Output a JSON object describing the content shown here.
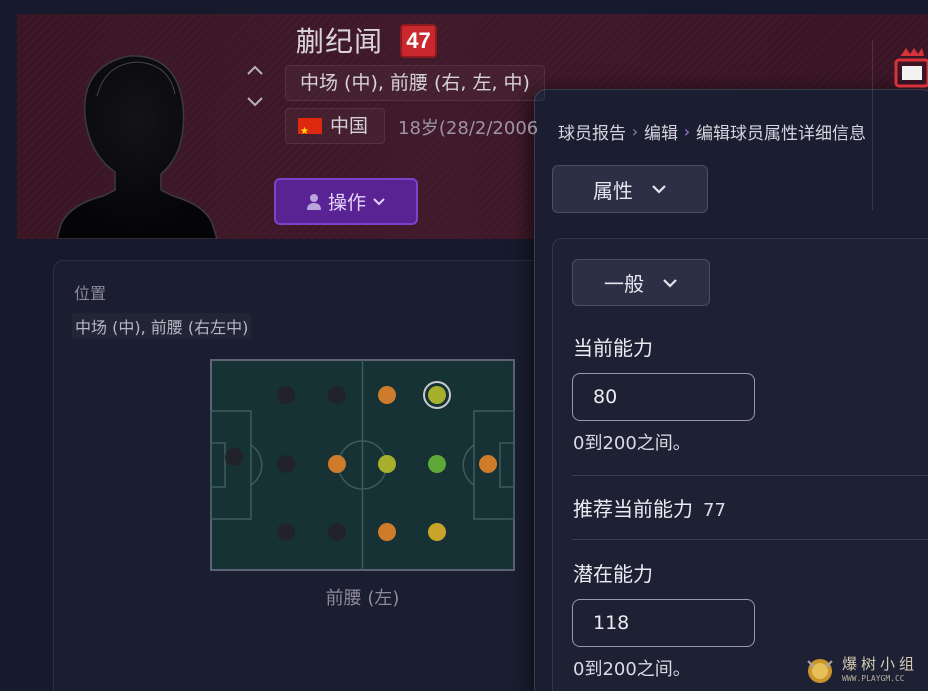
{
  "header": {
    "player_name": "蒯纪闻",
    "ability_badge": "47",
    "positions": "中场 (中), 前腰 (右, 左, 中)",
    "nation": "中国",
    "age": "18岁(28/2/2006",
    "action_button": "操作",
    "colors": {
      "band": "#3a1624",
      "badge": "#c8282e",
      "action": "#5a2394"
    }
  },
  "position_panel": {
    "label": "位置",
    "value": "中场 (中), 前腰 (右左中)",
    "pitch_caption": "前腰 (左)",
    "dot_colors": {
      "none": "#22222a",
      "orange": "#cf7b2c",
      "yellow": "#a6b02c",
      "green": "#5ea83a"
    }
  },
  "editor": {
    "breadcrumb": [
      "球员报告",
      "编辑",
      "编辑球员属性详细信息"
    ],
    "section_dropdown": "属性",
    "category_dropdown": "一般",
    "current_ability": {
      "label": "当前能力",
      "value": "80",
      "hint": "0到200之间。"
    },
    "recommended": {
      "label": "推荐当前能力",
      "value": "77"
    },
    "potential_ability": {
      "label": "潜在能力",
      "value": "118",
      "hint": "0到200之间。"
    }
  },
  "watermark": {
    "text": "爆树小组",
    "url": "WWW.PLAYGM.CC"
  }
}
